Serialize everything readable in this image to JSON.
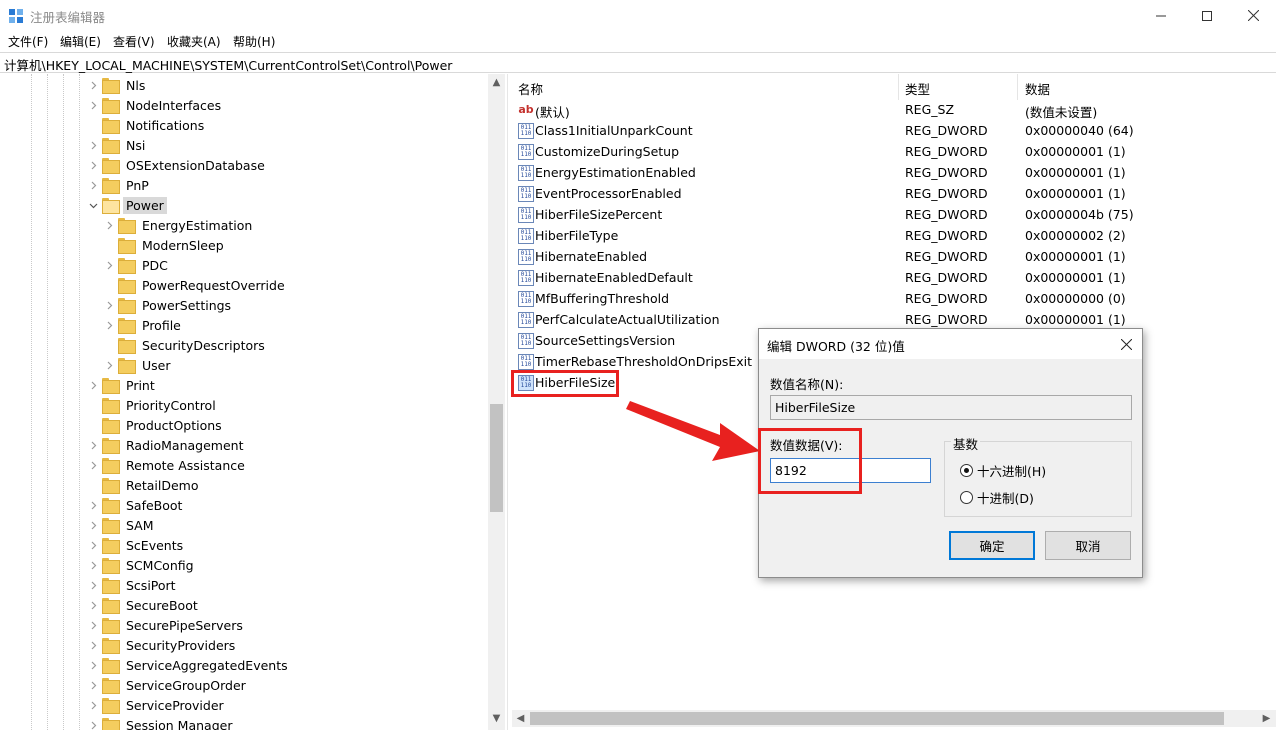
{
  "window": {
    "title": "注册表编辑器"
  },
  "menu": [
    "文件(F)",
    "编辑(E)",
    "查看(V)",
    "收藏夹(A)",
    "帮助(H)"
  ],
  "address": "计算机\\HKEY_LOCAL_MACHINE\\SYSTEM\\CurrentControlSet\\Control\\Power",
  "tree": {
    "items": [
      {
        "label": "Nls",
        "children": true
      },
      {
        "label": "NodeInterfaces",
        "children": true
      },
      {
        "label": "Notifications",
        "children": false
      },
      {
        "label": "Nsi",
        "children": true
      },
      {
        "label": "OSExtensionDatabase",
        "children": true
      },
      {
        "label": "PnP",
        "children": true
      },
      {
        "label": "Power",
        "children": true,
        "expanded": true,
        "selected": true
      },
      {
        "label": "EnergyEstimation",
        "children": true,
        "child": true
      },
      {
        "label": "ModernSleep",
        "children": false,
        "child": true
      },
      {
        "label": "PDC",
        "children": true,
        "child": true
      },
      {
        "label": "PowerRequestOverride",
        "children": false,
        "child": true
      },
      {
        "label": "PowerSettings",
        "children": true,
        "child": true
      },
      {
        "label": "Profile",
        "children": true,
        "child": true
      },
      {
        "label": "SecurityDescriptors",
        "children": false,
        "child": true
      },
      {
        "label": "User",
        "children": true,
        "child": true
      },
      {
        "label": "Print",
        "children": true
      },
      {
        "label": "PriorityControl",
        "children": false
      },
      {
        "label": "ProductOptions",
        "children": false
      },
      {
        "label": "RadioManagement",
        "children": true
      },
      {
        "label": "Remote Assistance",
        "children": true
      },
      {
        "label": "RetailDemo",
        "children": false
      },
      {
        "label": "SafeBoot",
        "children": true
      },
      {
        "label": "SAM",
        "children": true
      },
      {
        "label": "ScEvents",
        "children": true
      },
      {
        "label": "SCMConfig",
        "children": true
      },
      {
        "label": "ScsiPort",
        "children": true
      },
      {
        "label": "SecureBoot",
        "children": true
      },
      {
        "label": "SecurePipeServers",
        "children": true
      },
      {
        "label": "SecurityProviders",
        "children": true
      },
      {
        "label": "ServiceAggregatedEvents",
        "children": true
      },
      {
        "label": "ServiceGroupOrder",
        "children": true
      },
      {
        "label": "ServiceProvider",
        "children": true
      },
      {
        "label": "Session Manager",
        "children": true
      }
    ]
  },
  "list": {
    "headers": {
      "name": "名称",
      "type": "类型",
      "data": "数据"
    },
    "rows": [
      {
        "icon": "string-value-icon",
        "name": "(默认)",
        "type": "REG_SZ",
        "data": "(数值未设置)"
      },
      {
        "icon": "dword-value-icon",
        "name": "Class1InitialUnparkCount",
        "type": "REG_DWORD",
        "data": "0x00000040 (64)"
      },
      {
        "icon": "dword-value-icon",
        "name": "CustomizeDuringSetup",
        "type": "REG_DWORD",
        "data": "0x00000001 (1)"
      },
      {
        "icon": "dword-value-icon",
        "name": "EnergyEstimationEnabled",
        "type": "REG_DWORD",
        "data": "0x00000001 (1)"
      },
      {
        "icon": "dword-value-icon",
        "name": "EventProcessorEnabled",
        "type": "REG_DWORD",
        "data": "0x00000001 (1)"
      },
      {
        "icon": "dword-value-icon",
        "name": "HiberFileSizePercent",
        "type": "REG_DWORD",
        "data": "0x0000004b (75)"
      },
      {
        "icon": "dword-value-icon",
        "name": "HiberFileType",
        "type": "REG_DWORD",
        "data": "0x00000002 (2)"
      },
      {
        "icon": "dword-value-icon",
        "name": "HibernateEnabled",
        "type": "REG_DWORD",
        "data": "0x00000001 (1)"
      },
      {
        "icon": "dword-value-icon",
        "name": "HibernateEnabledDefault",
        "type": "REG_DWORD",
        "data": "0x00000001 (1)"
      },
      {
        "icon": "dword-value-icon",
        "name": "MfBufferingThreshold",
        "type": "REG_DWORD",
        "data": "0x00000000 (0)"
      },
      {
        "icon": "dword-value-icon",
        "name": "PerfCalculateActualUtilization",
        "type": "REG_DWORD",
        "data": "0x00000001 (1)"
      },
      {
        "icon": "dword-value-icon",
        "name": "SourceSettingsVersion",
        "type": "",
        "data": ""
      },
      {
        "icon": "dword-value-icon",
        "name": "TimerRebaseThresholdOnDripsExit",
        "type": "",
        "data": ""
      },
      {
        "icon": "dword-value-icon",
        "name": "HiberFileSize",
        "type": "",
        "data": "",
        "highlighted": true
      }
    ]
  },
  "dialog": {
    "title": "编辑 DWORD (32 位)值",
    "name_label": "数值名称(N):",
    "name_value": "HiberFileSize",
    "data_label": "数值数据(V):",
    "data_value": "8192",
    "base_label": "基数",
    "base_options": [
      {
        "label": "十六进制(H)",
        "checked": true
      },
      {
        "label": "十进制(D)",
        "checked": false
      }
    ],
    "ok_label": "确定",
    "cancel_label": "取消"
  },
  "colors": {
    "annotation": "#e8211f",
    "selection": "#d9d9d9",
    "folder": "#f4cd5f"
  }
}
